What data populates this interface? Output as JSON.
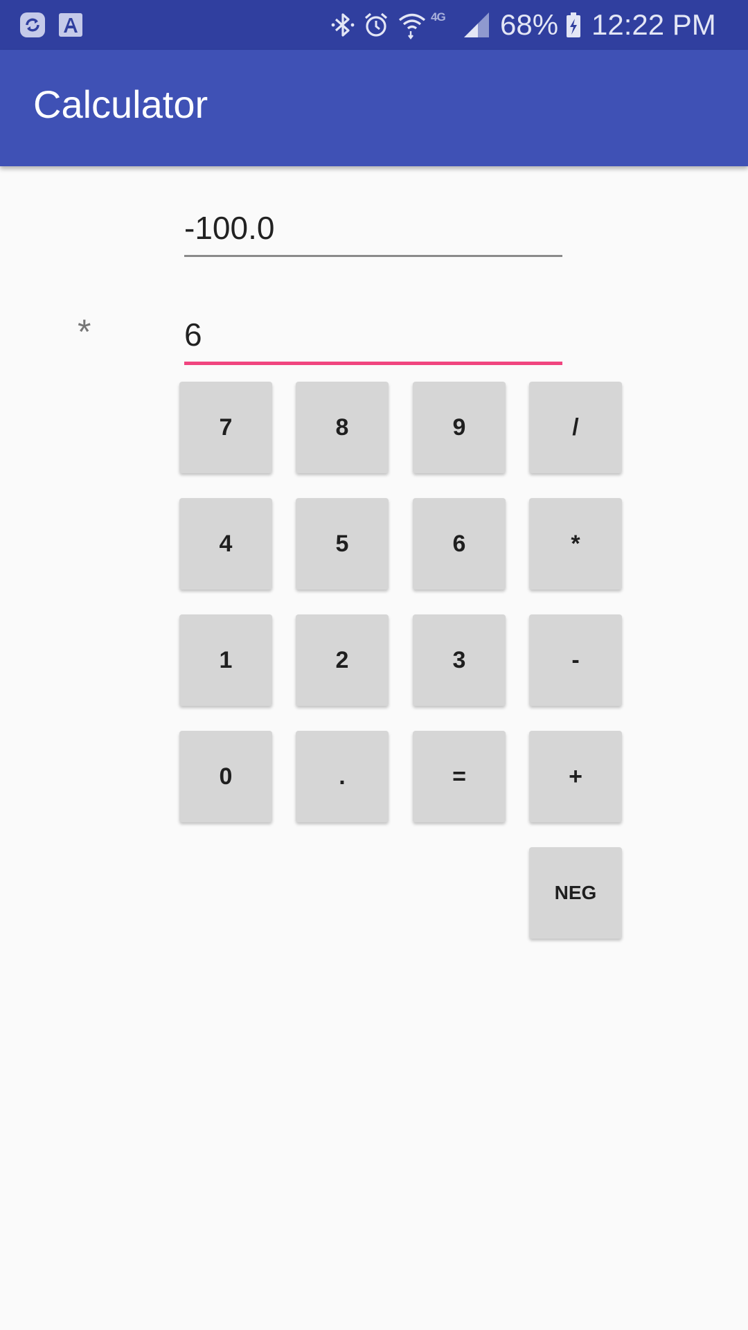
{
  "status_bar": {
    "network_label": "4G",
    "battery_percent": "68%",
    "time": "12:22 PM",
    "icons": [
      "sync-icon",
      "font-icon",
      "bluetooth-icon",
      "alarm-icon",
      "wifi-icon",
      "signal-icon",
      "battery-charging-icon"
    ]
  },
  "app_bar": {
    "title": "Calculator",
    "color": "#3f51b5"
  },
  "fields": {
    "first_value": "-100.0",
    "operator": "*",
    "second_value": "6",
    "accent_color": "#f0457f"
  },
  "keypad": {
    "key_7": "7",
    "key_8": "8",
    "key_9": "9",
    "key_divide": "/",
    "key_4": "4",
    "key_5": "5",
    "key_6": "6",
    "key_multiply": "*",
    "key_1": "1",
    "key_2": "2",
    "key_3": "3",
    "key_minus": "-",
    "key_0": "0",
    "key_dot": ".",
    "key_equals": "=",
    "key_plus": "+",
    "key_neg": "NEG"
  }
}
